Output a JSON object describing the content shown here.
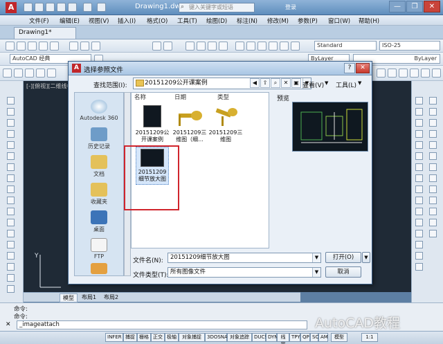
{
  "app": {
    "document_title": "Drawing1.dwg",
    "search_placeholder": "键入关键字或短语",
    "login_label": "登录",
    "window_buttons": [
      "—",
      "❐",
      "✕"
    ]
  },
  "menubar": {
    "items": [
      "文件(F)",
      "编辑(E)",
      "视图(V)",
      "插入(I)",
      "格式(O)",
      "工具(T)",
      "绘图(D)",
      "标注(N)",
      "修改(M)",
      "参数(P)",
      "窗口(W)",
      "帮助(H)"
    ]
  },
  "tabs": {
    "active": "Drawing1*"
  },
  "toolbar": {
    "workspace": "AutoCAD 经典",
    "text_style": "Standard",
    "dim_style": "ISO-25",
    "layer_color": "ByLayer",
    "linetype": "ByLayer"
  },
  "viewport": {
    "label": "[-][俯视][二维线框]"
  },
  "layout_tabs": [
    "模型",
    "布局1",
    "布局2"
  ],
  "command": {
    "history": [
      "命令:",
      "命令:"
    ],
    "current": "_imageattach"
  },
  "statusbar": {
    "buttons": [
      "INFER",
      "捕捉",
      "栅格",
      "正交",
      "极轴",
      "对象捕捉",
      "3DOSNAP",
      "对象追踪",
      "DUCS",
      "DYN",
      "线宽",
      "TPY",
      "QP",
      "SC",
      "AM"
    ],
    "model_label": "模型",
    "scale": "1:1"
  },
  "dialog": {
    "title": "选择参照文件",
    "help_button": "?",
    "close_button": "✕",
    "look_in_label": "查找范围(I):",
    "look_in_value": "20151209公开课案例",
    "view_menu": "查看(V)",
    "tools_menu": "工具(L)",
    "places": [
      "Autodesk 360",
      "历史记录",
      "文档",
      "收藏夹",
      "桌面",
      "FTP"
    ],
    "columns": [
      "名称",
      "日期",
      "类型"
    ],
    "files": [
      {
        "name": "20151209公开课案例",
        "kind": "dark"
      },
      {
        "name": "20151209三维图（细...",
        "kind": "gold"
      },
      {
        "name": "20151209三维图",
        "kind": "gold"
      },
      {
        "name": "20151209细节放大图",
        "kind": "dark"
      }
    ],
    "preview_label": "预览",
    "file_name_label": "文件名(N):",
    "file_name_value": "20151209细节放大图",
    "file_type_label": "文件类型(T):",
    "file_type_value": "所有图像文件",
    "open_button": "打开(O)",
    "cancel_button": "取消"
  },
  "watermark": "AutoCAD教程",
  "colors": {
    "highlight": "#d0242c",
    "title_bar": "#6f9bc7",
    "drawing_bg": "#1f2a36"
  }
}
